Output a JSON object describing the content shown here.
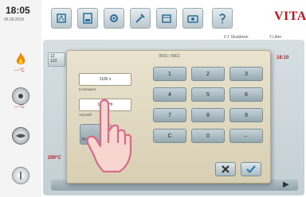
{
  "clock": {
    "time": "18:05",
    "date": "06.06.2018"
  },
  "brand": "VITA",
  "toolbar": {
    "status_left": "0 1 Shutdown",
    "status_right": "2 Lifter"
  },
  "sidebar": {
    "sub_labels": [
      "—°C",
      "—°C"
    ]
  },
  "workspace": {
    "left_tag": "12\n123",
    "right_temp": "18:10",
    "bottom_temp": "200°C"
  },
  "modal": {
    "title": "0001 / 0001",
    "field1_value": "1100 s",
    "field1_caption": "Kombiwert",
    "field2_value": "12:00 Hr",
    "field2_caption": "Vorwahl",
    "pre_button_label": "Pre-",
    "keys": [
      "1",
      "2",
      "3",
      "4",
      "5",
      "6",
      "7",
      "8",
      "9",
      "C",
      "0",
      "←"
    ]
  },
  "colors": {
    "brand": "#c4141b",
    "modal_bg": "#e3dcc4",
    "key": "#a9bbc2",
    "confirm": "#2d7ab8",
    "cancel": "#333333"
  }
}
